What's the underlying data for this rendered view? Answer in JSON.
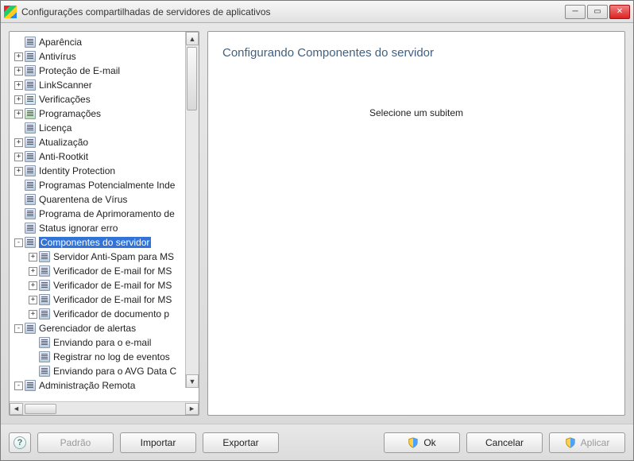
{
  "window": {
    "title": "Configurações compartilhadas de servidores de aplicativos"
  },
  "tree": {
    "items": [
      {
        "label": "Aparência",
        "level": 0,
        "exp": "",
        "sel": false
      },
      {
        "label": "Antivírus",
        "level": 0,
        "exp": "+",
        "sel": false
      },
      {
        "label": "Proteção de E-mail",
        "level": 0,
        "exp": "+",
        "sel": false
      },
      {
        "label": "LinkScanner",
        "level": 0,
        "exp": "+",
        "sel": false
      },
      {
        "label": "Verificações",
        "level": 0,
        "exp": "+",
        "sel": false,
        "icon": "special1"
      },
      {
        "label": "Programações",
        "level": 0,
        "exp": "+",
        "sel": false,
        "icon": "special2"
      },
      {
        "label": "Licença",
        "level": 0,
        "exp": "",
        "sel": false
      },
      {
        "label": "Atualização",
        "level": 0,
        "exp": "+",
        "sel": false
      },
      {
        "label": "Anti-Rootkit",
        "level": 0,
        "exp": "+",
        "sel": false
      },
      {
        "label": "Identity Protection",
        "level": 0,
        "exp": "+",
        "sel": false
      },
      {
        "label": "Programas Potencialmente Inde",
        "level": 0,
        "exp": "",
        "sel": false
      },
      {
        "label": "Quarentena de Vírus",
        "level": 0,
        "exp": "",
        "sel": false
      },
      {
        "label": "Programa de Aprimoramento de",
        "level": 0,
        "exp": "",
        "sel": false
      },
      {
        "label": "Status ignorar erro",
        "level": 0,
        "exp": "",
        "sel": false
      },
      {
        "label": "Componentes do servidor",
        "level": 0,
        "exp": "-",
        "sel": true
      },
      {
        "label": "Servidor Anti-Spam para MS",
        "level": 1,
        "exp": "+",
        "sel": false
      },
      {
        "label": "Verificador de E-mail for MS",
        "level": 1,
        "exp": "+",
        "sel": false
      },
      {
        "label": "Verificador de E-mail for MS",
        "level": 1,
        "exp": "+",
        "sel": false
      },
      {
        "label": "Verificador de E-mail for MS",
        "level": 1,
        "exp": "+",
        "sel": false
      },
      {
        "label": "Verificador de documento p",
        "level": 1,
        "exp": "+",
        "sel": false
      },
      {
        "label": "Gerenciador de alertas",
        "level": 0,
        "exp": "-",
        "sel": false
      },
      {
        "label": "Enviando para o e-mail",
        "level": 1,
        "exp": "",
        "sel": false
      },
      {
        "label": "Registrar no log de eventos",
        "level": 1,
        "exp": "",
        "sel": false
      },
      {
        "label": "Enviando para o AVG Data C",
        "level": 1,
        "exp": "",
        "sel": false
      },
      {
        "label": "Administração Remota",
        "level": 0,
        "exp": "-",
        "sel": false
      }
    ]
  },
  "detail": {
    "title": "Configurando Componentes do servidor",
    "message": "Selecione um subitem"
  },
  "buttons": {
    "help": "?",
    "default": "Padrão",
    "import": "Importar",
    "export": "Exportar",
    "ok": "Ok",
    "cancel": "Cancelar",
    "apply": "Aplicar"
  }
}
